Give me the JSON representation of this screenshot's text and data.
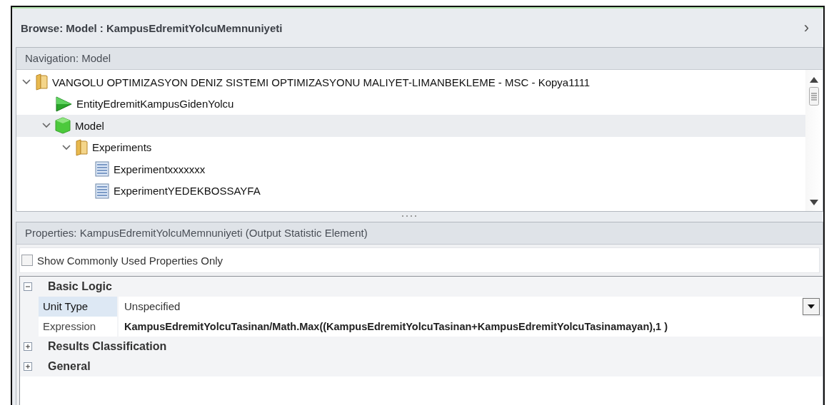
{
  "browse": {
    "title": "Browse: Model : KampusEdremitYolcuMemnuniyeti",
    "nav_glyph": "›"
  },
  "navigation": {
    "header": "Navigation: Model",
    "tree": [
      {
        "label": "VANGOLU OPTIMIZASYON DENIZ SISTEMI OPTIMIZASYONU MALIYET-LIMANBEKLEME - MSC - Kopya1111",
        "kind": "folder",
        "expanded": true,
        "selected": false,
        "children": [
          {
            "label": "EntityEdremitKampusGidenYolcu",
            "kind": "entity",
            "selected": false
          },
          {
            "label": "Model",
            "kind": "model",
            "expanded": true,
            "selected": true,
            "children": [
              {
                "label": "Experiments",
                "kind": "folder",
                "expanded": true,
                "selected": false,
                "children": [
                  {
                    "label": "Experimentxxxxxxx",
                    "kind": "experiment",
                    "selected": false
                  },
                  {
                    "label": "ExperimentYEDEKBOSSAYFA",
                    "kind": "experiment",
                    "selected": false
                  }
                ]
              }
            ]
          }
        ]
      }
    ]
  },
  "properties": {
    "header": "Properties: KampusEdremitYolcuMemnuniyeti (Output Statistic Element)",
    "common_only": {
      "label": "Show Commonly Used Properties Only",
      "checked": false
    },
    "categories": [
      {
        "name": "Basic Logic",
        "expanded": true,
        "rows": [
          {
            "name": "Unit Type",
            "value": "Unspecified",
            "selected": true,
            "modified": false,
            "dropdown": true
          },
          {
            "name": "Expression",
            "value": "KampusEdremitYolcuTasinan/Math.Max((KampusEdremitYolcuTasinan+KampusEdremitYolcuTasinamayan),1 )",
            "selected": false,
            "modified": true,
            "dropdown": false
          }
        ]
      },
      {
        "name": "Results Classification",
        "expanded": false
      },
      {
        "name": "General",
        "expanded": false
      }
    ]
  }
}
